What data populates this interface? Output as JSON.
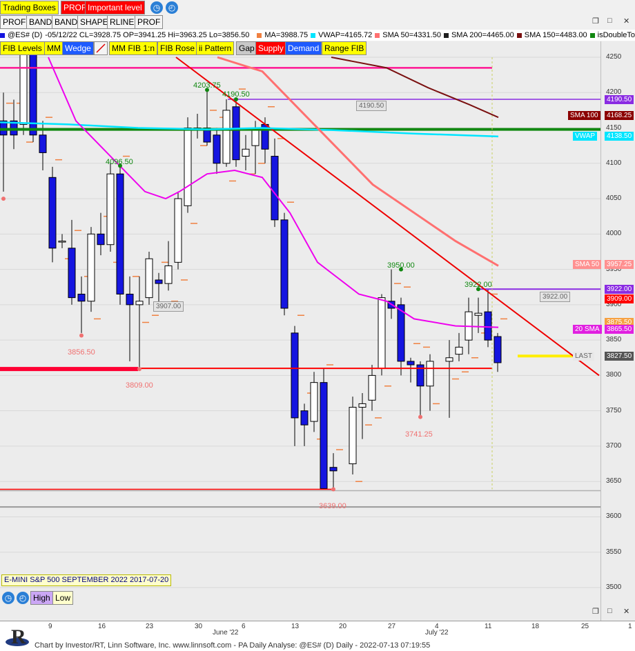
{
  "toolbar_row1": {
    "trading_boxes": "Trading Boxes",
    "prof": "PROF",
    "important_level": "Important level"
  },
  "toolbar_row2": [
    "PROF",
    "BAND",
    "BAND",
    "SHAPE",
    "RLINE",
    "PROF"
  ],
  "legend": {
    "symbol": "@ES# (D)",
    "ohlc": "-05/12/22 CL=3928.75 OP=3941.25 Hi=3963.25 Lo=3856.50",
    "items": [
      {
        "label": "MA=3988.75",
        "color": "#f08040"
      },
      {
        "label": "VWAP=4165.72",
        "color": "#00e5ff"
      },
      {
        "label": "SMA 50=4331.50",
        "color": "#ff7070"
      },
      {
        "label": "SMA 200=4465.00",
        "color": "#202020"
      },
      {
        "label": "SMA 150=4483.00",
        "color": "#7a1010"
      },
      {
        "label": "isDoubleTo",
        "color": "#118811"
      }
    ]
  },
  "drawing_toolbar": [
    {
      "label": "FIB Levels",
      "style": "yellow"
    },
    {
      "label": "MM",
      "style": "yellow"
    },
    {
      "label": "Wedge",
      "style": "blue"
    },
    {
      "label": "MM FIB 1:n",
      "style": "yellow"
    },
    {
      "label": "FIB Rose",
      "style": "yellow"
    },
    {
      "label": "ii Pattern",
      "style": "yellow"
    },
    {
      "label": "Gap",
      "style": "gray"
    },
    {
      "label": "Supply",
      "style": "red"
    },
    {
      "label": "Demand",
      "style": "blue"
    },
    {
      "label": "Range FIB",
      "style": "yellow"
    }
  ],
  "axis_ticks": [
    "4250",
    "4200",
    "4150",
    "4100",
    "4050",
    "4000",
    "3950",
    "3900",
    "3850",
    "3800",
    "3750",
    "3700",
    "3650",
    "3600",
    "3550",
    "3500"
  ],
  "price_tags": [
    {
      "label": "4190.50",
      "price": 4190.5,
      "bg": "#8a2be2",
      "fg": "#ffffff"
    },
    {
      "label": "SMA 100",
      "side": "left",
      "price": 4168.25,
      "bg": "#8b0000",
      "fg": "#ffffff"
    },
    {
      "label": "4168.25",
      "price": 4168.25,
      "bg": "#8b0000",
      "fg": "#ffffff"
    },
    {
      "label": "VWAP",
      "side": "left",
      "price": 4138.5,
      "bg": "#00e5ff",
      "fg": "#ffffff"
    },
    {
      "label": "4138.50",
      "price": 4138.5,
      "bg": "#00e5ff",
      "fg": "#ffffff"
    },
    {
      "label": "SMA 50",
      "side": "left",
      "price": 3957.25,
      "bg": "#ff9090",
      "fg": "#ffffff"
    },
    {
      "label": "3957.25",
      "price": 3957.25,
      "bg": "#ff9090",
      "fg": "#ffffff"
    },
    {
      "label": "3922.00",
      "price": 3922,
      "bg": "#8a2be2",
      "fg": "#ffffff"
    },
    {
      "label": "3909.00",
      "price": 3909,
      "bg": "#ff0000",
      "fg": "#ffffff"
    },
    {
      "label": "3875.50",
      "price": 3875.5,
      "bg": "#f6a040",
      "fg": "#ffffff"
    },
    {
      "label": "20 SMA",
      "side": "left",
      "price": 3865.5,
      "bg": "#e020e0",
      "fg": "#ffffff"
    },
    {
      "label": "3865.50",
      "price": 3865.5,
      "bg": "#e020e0",
      "fg": "#ffffff"
    },
    {
      "label": "LAST",
      "side": "left",
      "price": 3827.5,
      "bg": "#e8e8e8",
      "fg": "#666666"
    },
    {
      "label": "3827.50",
      "price": 3827.5,
      "bg": "#555555",
      "fg": "#ffffff"
    }
  ],
  "annotations": [
    {
      "label": "4203.75",
      "color": "#118811"
    },
    {
      "label": "4190.50",
      "color": "#118811"
    },
    {
      "label": "4096.50",
      "color": "#118811"
    },
    {
      "label": "3950.00",
      "color": "#118811"
    },
    {
      "label": "3922.00",
      "color": "#118811"
    },
    {
      "label": "3856.50",
      "color": "#f07070"
    },
    {
      "label": "3809.00",
      "color": "#f07070"
    },
    {
      "label": "3741.25",
      "color": "#f07070"
    },
    {
      "label": "3639.00",
      "color": "#f07070"
    }
  ],
  "line_labels": [
    "4190.50",
    "3907.00",
    "3922.00"
  ],
  "contract": "E-MINI S&P 500 SEPTEMBER 2022 2017-07-20",
  "bottom_buttons": {
    "high": "High",
    "low": "Low"
  },
  "date_axis": [
    "9",
    "16",
    "23",
    "30",
    "June '22",
    "6",
    "13",
    "20",
    "27",
    "4",
    "July '22",
    "11",
    "18",
    "25",
    "1"
  ],
  "footer_text": "Chart by Investor/RT, Linn Software, Inc. www.linnsoft.com - PA Daily Analyse: @ES# (D) Daily - 2022-07-13 07:19:55",
  "logo_letter": "R",
  "colors": {
    "bull": "#ffffff",
    "bear": "#1515e0",
    "supply": "#ff0000",
    "magenta": "#ee00ee"
  }
}
